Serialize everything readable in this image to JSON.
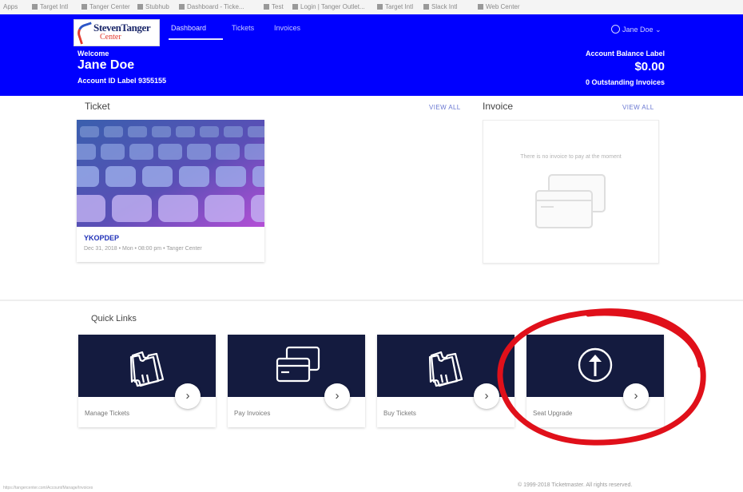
{
  "bookmarks": [
    "Apps",
    "Target Intl",
    "Tanger Center",
    "Stubhub",
    "Dashboard - Ticke...",
    "Test",
    "Login | Tanger Outlet...",
    "Target Intl",
    "Slack Intl",
    "Web Center"
  ],
  "header": {
    "nav": [
      "Dashboard",
      "Tickets",
      "Invoices"
    ],
    "user": "Jane Doe",
    "welcome": "Welcome",
    "name": "Jane Doe",
    "account_id": "Account ID Label 9355155",
    "balance_label": "Account Balance Label",
    "balance_value": "$0.00",
    "outstanding": "0 Outstanding Invoices",
    "logo_line1": "StevenTanger",
    "logo_line2": "Center"
  },
  "ticket_section": {
    "title": "Ticket",
    "view_all": "VIEW ALL",
    "card": {
      "code": "YKOPDEP",
      "meta": "Dec 31, 2018 • Mon • 08:00 pm • Tanger Center"
    }
  },
  "invoice_section": {
    "title": "Invoice",
    "view_all": "VIEW ALL",
    "empty_text": "There is no invoice to pay at the moment"
  },
  "quick_links": {
    "title": "Quick Links",
    "items": [
      {
        "label": "Manage Tickets",
        "icon": "tickets-icon"
      },
      {
        "label": "Pay Invoices",
        "icon": "credit-cards-icon"
      },
      {
        "label": "Buy Tickets",
        "icon": "tickets-icon"
      },
      {
        "label": "Seat Upgrade",
        "icon": "upgrade-arrow-icon"
      }
    ],
    "arrow": "›"
  },
  "footer": {
    "left": "https://tangercenter.com/Account/Manage/Invoices",
    "right": "© 1999-2018 Ticketmaster. All rights reserved."
  },
  "colors": {
    "header_bg": "#0000ff",
    "quick_link_bg": "#141b3f",
    "annotation": "#e0101a"
  }
}
